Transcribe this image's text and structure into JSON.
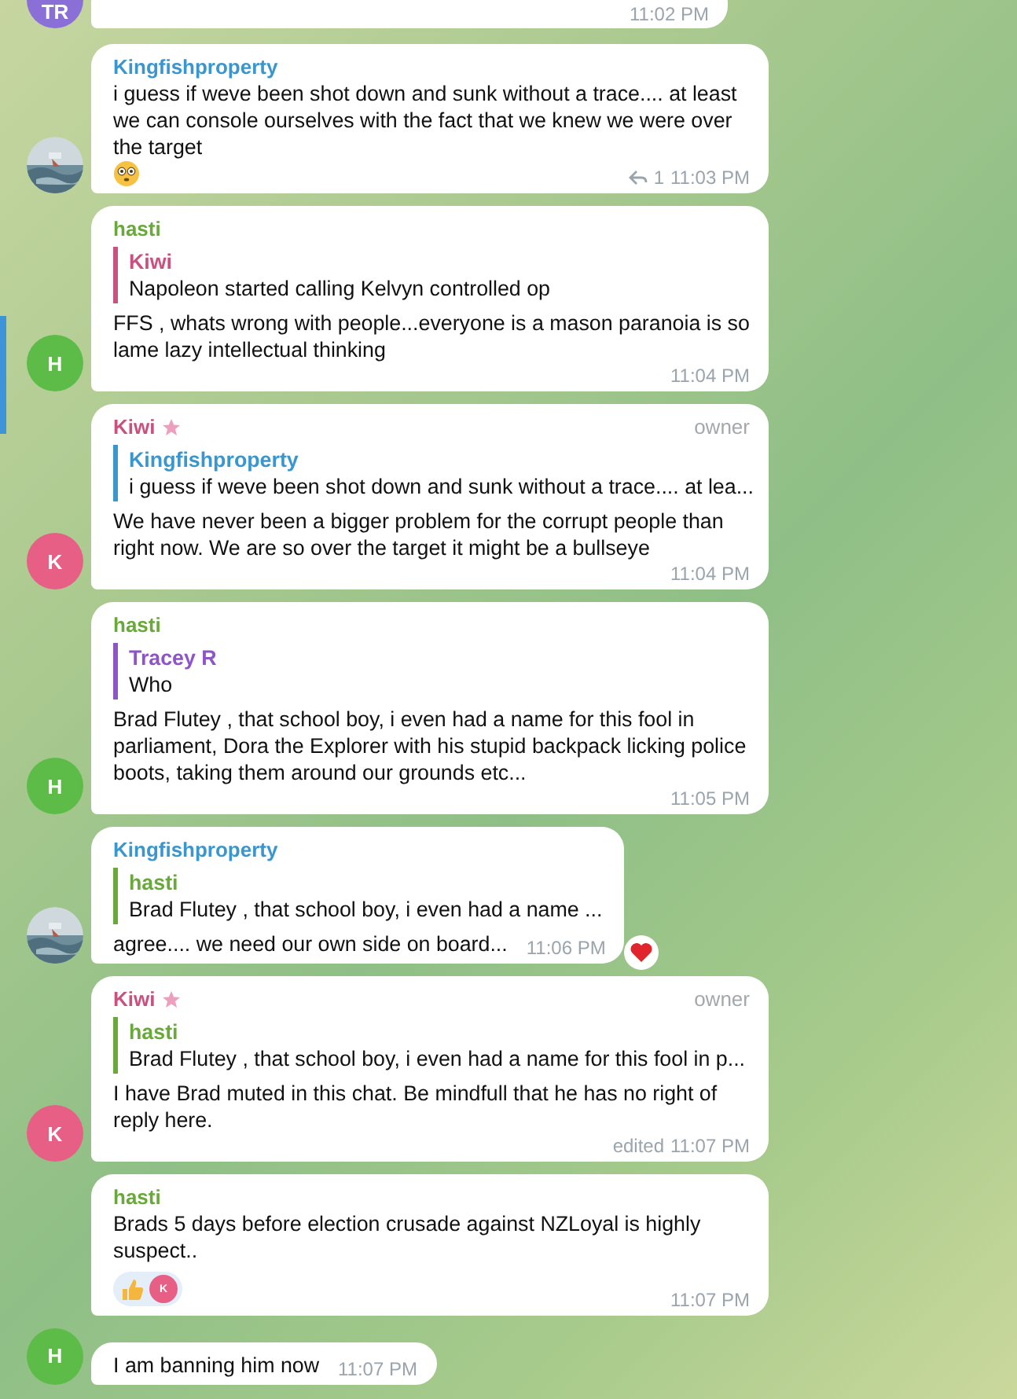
{
  "messages": [
    {
      "partial": true,
      "avatar": {
        "kind": "initials",
        "initials": "TR",
        "color": "#8a70d6"
      },
      "time": "11:02 PM"
    },
    {
      "sender": {
        "name": "Kingfishproperty",
        "color": "#3a96cf"
      },
      "text": "i guess if weve been shot down and sunk without a trace.... at least we can console ourselves with the fact that we knew we were over the target",
      "trailing_icon": {
        "kind": "flushed-face"
      },
      "reply_count": "1",
      "time": "11:03 PM"
    },
    {
      "sender": {
        "name": "hasti",
        "color": "#68a93a"
      },
      "avatar": {
        "kind": "initials",
        "initials": "H",
        "color": "#5cbc47"
      },
      "reply": {
        "name": "Kiwi",
        "color": "#c9507f",
        "text": "Napoleon started calling Kelvyn controlled op"
      },
      "text": "FFS , whats wrong with people...everyone is a mason paranoia is so lame lazy intellectual thinking",
      "time": "11:04 PM",
      "selected": true
    },
    {
      "sender": {
        "name": "Kiwi",
        "color": "#c9507f"
      },
      "star": true,
      "badge": "owner",
      "avatar": {
        "kind": "initials",
        "initials": "K",
        "color": "#e85f86"
      },
      "reply": {
        "name": "Kingfishproperty",
        "color": "#3a96cf",
        "text": "i guess if weve been shot down and sunk without a trace.... at lea..."
      },
      "text": "We have never been a bigger problem for the corrupt people than right now. We are so over the target it might be a bullseye",
      "time": "11:04 PM"
    },
    {
      "sender": {
        "name": "hasti",
        "color": "#68a93a"
      },
      "avatar": {
        "kind": "initials",
        "initials": "H",
        "color": "#5cbc47"
      },
      "reply": {
        "name": "Tracey R",
        "color": "#8e55c9",
        "text": "Who"
      },
      "text": "Brad Flutey , that school boy, i even had a name for this fool in parliament, Dora the Explorer with his stupid backpack licking police boots, taking them around our grounds etc...",
      "time": "11:05 PM"
    },
    {
      "sender": {
        "name": "Kingfishproperty",
        "color": "#3a96cf"
      },
      "reply": {
        "name": "hasti",
        "color": "#68a93a",
        "text": "Brad Flutey , that school boy, i even had a name ..."
      },
      "text": "agree.... we need our own side on board...",
      "time": "11:06 PM",
      "side_reactions": [
        {
          "kind": "heart"
        }
      ]
    },
    {
      "sender": {
        "name": "Kiwi",
        "color": "#c9507f"
      },
      "star": true,
      "badge": "owner",
      "avatar": {
        "kind": "initials",
        "initials": "K",
        "color": "#e85f86"
      },
      "reply": {
        "name": "hasti",
        "color": "#68a93a",
        "text": "Brad Flutey , that school boy, i even had a name for this fool in p..."
      },
      "text": "I have Brad muted in this chat. Be mindfull that he has no right of reply here.",
      "edited": "edited",
      "time": "11:07 PM"
    },
    {
      "sender": {
        "name": "hasti",
        "color": "#68a93a"
      },
      "text": "Brads 5 days before election crusade against NZLoyal is highly suspect..",
      "time": "11:07 PM",
      "reactions": [
        {
          "kind": "thumbs-up",
          "reactor": {
            "initial": "K",
            "color": "#e85f86"
          }
        }
      ]
    },
    {
      "avatar": {
        "kind": "initials",
        "initials": "H",
        "color": "#5cbc47"
      },
      "text": "I am banning him now",
      "time": "11:07 PM"
    }
  ]
}
